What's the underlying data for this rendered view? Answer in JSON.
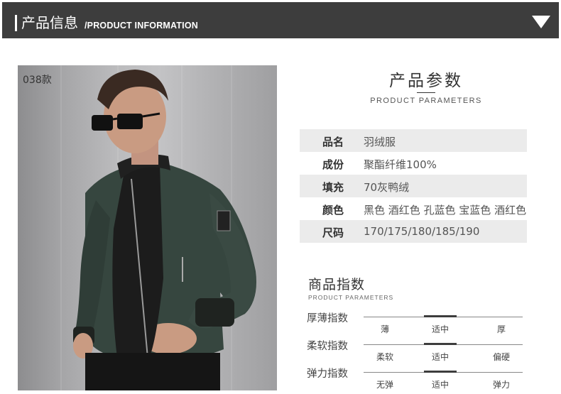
{
  "header": {
    "title": "产品信息",
    "subtitle": "/PRODUCT INFORMATION",
    "toggle_icon": "chevron-down-triangle"
  },
  "photo": {
    "style_tag": "038款"
  },
  "parameters": {
    "title": "产品参数",
    "subtitle": "PRODUCT PARAMETERS",
    "rows": [
      {
        "key": "品名",
        "value": "羽绒服"
      },
      {
        "key": "成份",
        "value": "聚酯纤维100%"
      },
      {
        "key": "填充",
        "value": "70灰鸭绒"
      },
      {
        "key": "颜色",
        "value": "黑色 酒红色 孔蓝色 宝蓝色 酒红色"
      },
      {
        "key": "尺码",
        "value": "170/175/180/185/190"
      }
    ]
  },
  "index": {
    "title": "商品指数",
    "subtitle": "PRODUCT PARAMETERS",
    "scales": [
      {
        "label": "厚薄指数",
        "options": [
          "薄",
          "适中",
          "厚"
        ],
        "selected": 1
      },
      {
        "label": "柔软指数",
        "options": [
          "柔软",
          "适中",
          "偏硬"
        ],
        "selected": 1
      },
      {
        "label": "弹力指数",
        "options": [
          "无弹",
          "适中",
          "弹力"
        ],
        "selected": 1
      }
    ]
  },
  "colors": {
    "header_bg": "#3d3d3d",
    "row_shade": "#ebebeb",
    "jacket": "#36463f"
  }
}
